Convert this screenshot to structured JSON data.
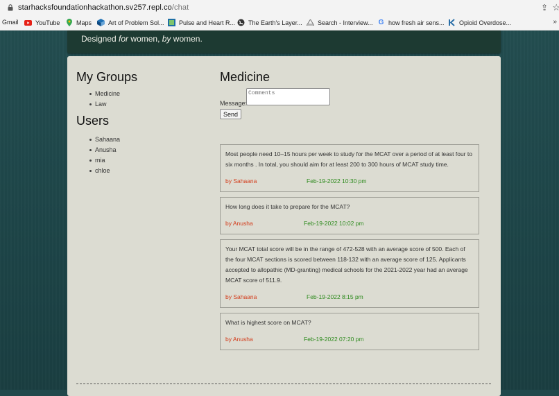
{
  "browser": {
    "url_host": "starhacksfoundationhackathon.sv257.repl.co",
    "url_path": "/chat",
    "bookmarks": [
      {
        "label": "Gmail",
        "icon": "gmail-icon"
      },
      {
        "label": "YouTube",
        "icon": "youtube-icon"
      },
      {
        "label": "Maps",
        "icon": "maps-icon"
      },
      {
        "label": "Art of Problem Sol...",
        "icon": "aops-icon"
      },
      {
        "label": "Pulse and Heart R...",
        "icon": "pulse-icon"
      },
      {
        "label": "The Earth's Layer...",
        "icon": "earth-icon"
      },
      {
        "label": "Search - Interview...",
        "icon": "search-icon"
      },
      {
        "label": "how fresh air sens...",
        "icon": "google-icon"
      },
      {
        "label": "Opioid Overdose...",
        "icon": "opioid-icon"
      }
    ],
    "more": "»"
  },
  "header": {
    "tagline_1": "Designed ",
    "tagline_2": "for",
    "tagline_3": " women, ",
    "tagline_4": "by",
    "tagline_5": " women."
  },
  "sidebar": {
    "groups_title": "My Groups",
    "groups": [
      "Medicine",
      "Law"
    ],
    "users_title": "Users",
    "users": [
      "Sahaana",
      "Anusha",
      "mia",
      "chloe"
    ]
  },
  "chat": {
    "title": "Medicine",
    "message_label": "Message:",
    "message_placeholder": "Comments",
    "send_label": "Send"
  },
  "posts": [
    {
      "text": "Most people need 10–15 hours per week to study for the MCAT over a period of at least four to six months . In total, you should aim for at least 200 to 300 hours of MCAT study time.",
      "author": "by Sahaana",
      "date": "Feb-19-2022 10:30 pm"
    },
    {
      "text": "How long does it take to prepare for the MCAT?",
      "author": "by Anusha",
      "date": "Feb-19-2022 10:02 pm"
    },
    {
      "text": "Your MCAT total score will be in the range of 472-528 with an average score of 500. Each of the four MCAT sections is scored between 118-132 with an average score of 125. Applicants accepted to allopathic (MD-granting) medical schools for the 2021-2022 year had an average MCAT score of 511.9.",
      "author": "by Sahaana",
      "date": "Feb-19-2022 8:15 pm"
    },
    {
      "text": "What is highest score on MCAT?",
      "author": "by Anusha",
      "date": "Feb-19-2022 07:20 pm"
    }
  ],
  "colors": {
    "author": "#d33b1a",
    "date": "#2c8a1c",
    "panel": "#dcdcd2",
    "background": "#21494c"
  }
}
